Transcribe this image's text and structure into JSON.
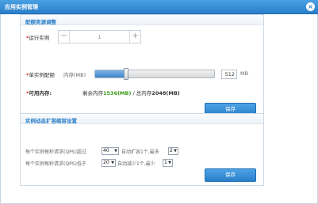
{
  "window": {
    "title": "应用实例管理",
    "close_glyph": "×"
  },
  "resource_panel": {
    "title": "配额资源调整",
    "instances": {
      "label": "运行实例",
      "required_mark": "*",
      "value": "1",
      "minus": "−",
      "plus": "+"
    },
    "quota": {
      "label": "单实例配额",
      "required_mark": "*",
      "sub_label": "内存(MB)",
      "level_fraction": 0.26,
      "value": "512",
      "unit": "MB"
    },
    "available": {
      "label": "可用内存:",
      "required_mark": "*",
      "remaining_prefix": "剩余内存",
      "remaining_value": "1536(MB)",
      "separator": " / ",
      "total_prefix": "总内存",
      "total_value": "2048(MB)"
    },
    "save_label": "保存"
  },
  "scale_panel": {
    "title": "实例动态扩容缩容设置",
    "rule_up": {
      "text_before": "每个实例每秒请求(QPS)超过",
      "threshold": "40",
      "text_middle": "自动扩容1个,最多",
      "max": "2"
    },
    "rule_down": {
      "text_before": "每个实例每秒请求(QPS)低于",
      "threshold": "20",
      "text_middle": "自动减少1个,最少",
      "min": "1"
    },
    "save_label": "保存"
  },
  "colors": {
    "accent": "#2a7fc9",
    "required": "#dd2222",
    "green": "#3a9a1a"
  }
}
